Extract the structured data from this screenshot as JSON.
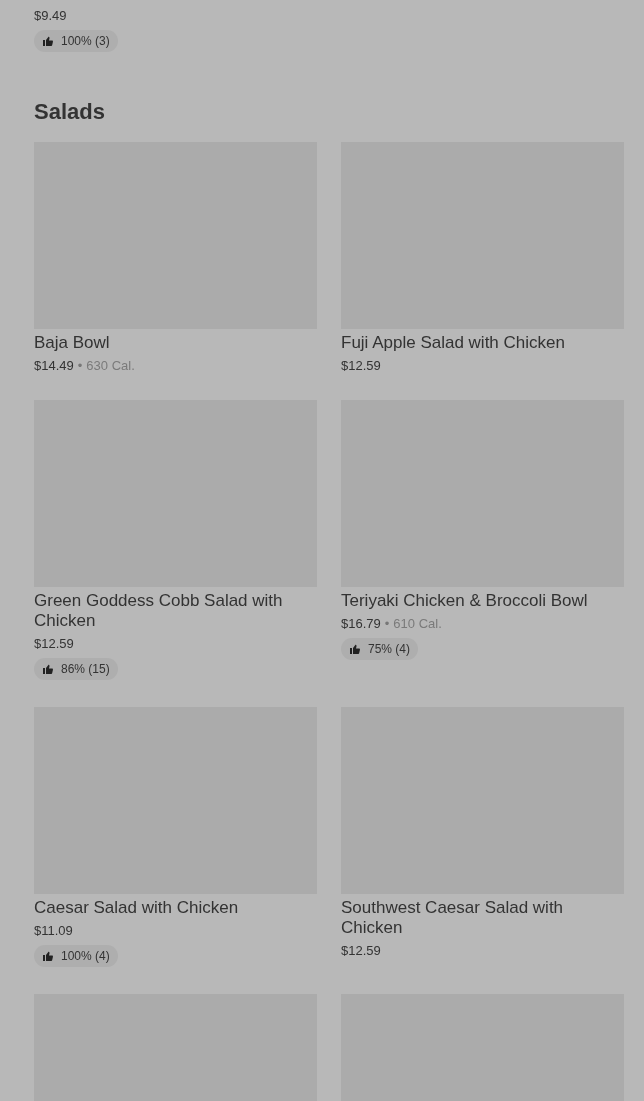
{
  "previous_item": {
    "price": "$9.49",
    "rating": "100% (3)"
  },
  "section": {
    "title": "Salads",
    "items": [
      {
        "kind": "card",
        "name": "Baja Bowl",
        "price": "$14.49",
        "separator": "•",
        "calories": "630 Cal."
      },
      {
        "kind": "card",
        "name": "Fuji Apple Salad with Chicken",
        "price": "$12.59"
      },
      {
        "kind": "card",
        "name": "Green Goddess Cobb Salad with Chicken",
        "price": "$12.59",
        "rating": "86% (15)"
      },
      {
        "kind": "card",
        "name": "Teriyaki Chicken & Broccoli Bowl",
        "price": "$16.79",
        "separator": "•",
        "calories": "610 Cal.",
        "rating": "75% (4)"
      },
      {
        "kind": "card",
        "name": "Caesar Salad with Chicken",
        "price": "$11.09",
        "rating": "100% (4)"
      },
      {
        "kind": "card",
        "name": "Southwest Caesar Salad with Chicken",
        "price": "$12.59"
      },
      {
        "kind": "partial"
      },
      {
        "kind": "partial"
      }
    ]
  }
}
